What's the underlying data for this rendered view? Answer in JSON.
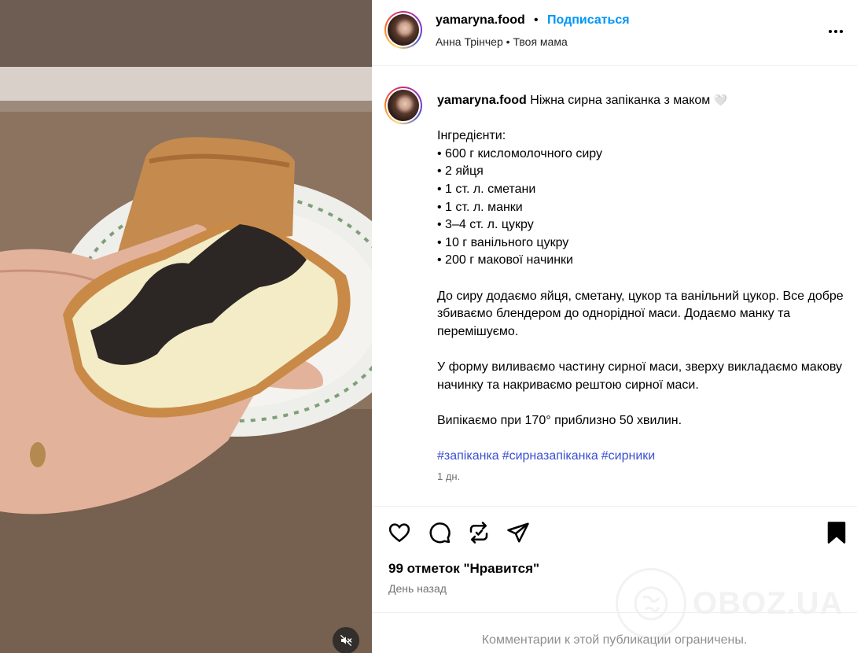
{
  "post": {
    "username": "yamaryna.food",
    "follow_label": "Подписаться",
    "separator": "•",
    "audio_artist": "Анна Трінчер",
    "audio_title": "Твоя мама"
  },
  "caption": {
    "username": "yamaryna.food",
    "title": "Ніжна сирна запіканка з маком",
    "emoji": "🤍",
    "ingredients_heading": "Інгредієнти:",
    "ingredients": [
      "• 600 г кисломолочного сиру",
      "• 2 яйця",
      "• 1 ст. л. сметани",
      "• 1 ст. л. манки",
      "• 3–4 ст. л. цукру",
      "• 10 г ванільного цукру",
      "• 200 г макової начинки"
    ],
    "step1": "До сиру додаємо яйця, сметану, цукор та ванільний цукор. Все добре збиваємо блендером до однорідної маси. Додаємо манку та перемішуємо.",
    "step2": "У форму виливаємо частину сирної маси, зверху викладаємо макову начинку та накриваємо рештою сирної маси.",
    "step3": "Випікаємо при 170° приблизно 50 хвилин.",
    "hashtags": [
      "#запіканка",
      "#сирназапіканка",
      "#сирники"
    ],
    "time": "1 дн."
  },
  "stats": {
    "likes": "99 отметок \"Нравится\"",
    "posted": "День назад"
  },
  "footer": {
    "comments_limited": "Комментарии к этой публикации ограничены."
  },
  "watermark": {
    "text": "OBOZ.UA"
  },
  "icons": {
    "like": "heart-icon",
    "comment": "comment-icon",
    "repost": "repost-icon",
    "share": "share-icon",
    "save": "bookmark-icon",
    "more": "more-icon",
    "mute": "muted-speaker-icon"
  },
  "colors": {
    "follow": "#0095f6",
    "hashtag": "#3b4fd1",
    "secondary_text": "#737373"
  }
}
